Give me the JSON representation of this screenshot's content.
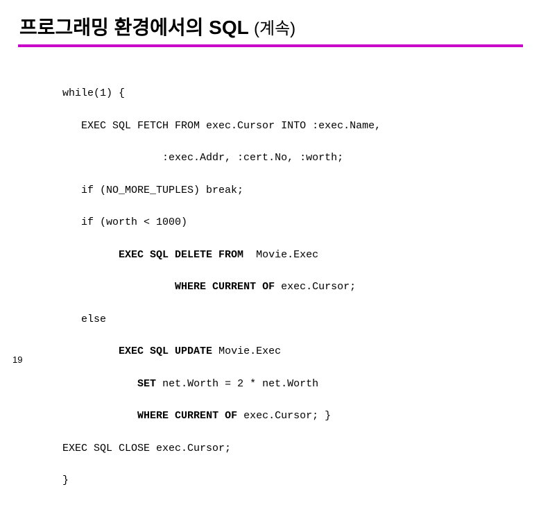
{
  "title": {
    "main": "프로그래밍 환경에서의 SQL",
    "sub": "(계속)"
  },
  "code": {
    "l1": "          while(1) {",
    "l2": "             EXEC SQL FETCH FROM exec.Cursor INTO :exec.Name,",
    "l3": "                          :exec.Addr, :cert.No, :worth;",
    "l4": "             if (NO_MORE_TUPLES) break;",
    "l5": "             if (worth < 1000)",
    "l6a": "                   ",
    "l6b": "EXEC SQL DELETE FROM ",
    "l6c": " Movie.Exec",
    "l7a": "                            ",
    "l7b": "WHERE CURRENT OF ",
    "l7c": "exec.Cursor;",
    "l8": "             else",
    "l9a": "                   ",
    "l9b": "EXEC SQL UPDATE ",
    "l9c": "Movie.Exec",
    "l10a": "                      ",
    "l10b": "SET ",
    "l10c": "net.Worth = 2 * net.Worth",
    "l11a": "                      ",
    "l11b": "WHERE CURRENT OF ",
    "l11c": "exec.Cursor; }",
    "l12": "          EXEC SQL CLOSE exec.Cursor;",
    "l13": "          }"
  },
  "pagenum": "19"
}
